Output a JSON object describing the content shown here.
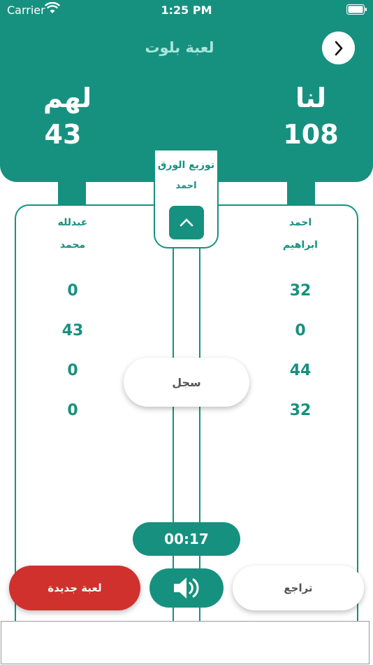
{
  "status_bar": {
    "carrier": "Carrier",
    "time": "1:25 PM"
  },
  "header": {
    "title": "لعبة بلوت",
    "team_us": {
      "label": "لنا",
      "score": "108"
    },
    "team_them": {
      "label": "لهم",
      "score": "43"
    }
  },
  "dealer": {
    "title": "توزيع الورق",
    "name": "احمد"
  },
  "players": {
    "us": [
      "احمد",
      "ابراهيم"
    ],
    "them": [
      "عبدلله",
      "محمد"
    ]
  },
  "rounds": {
    "us": [
      "32",
      "0",
      "44",
      "32"
    ],
    "them": [
      "0",
      "43",
      "0",
      "0"
    ]
  },
  "buttons": {
    "record": "سجل",
    "new_game": "لعبة جديدة",
    "undo": "تراجع"
  },
  "timer": "00:17",
  "colors": {
    "primary": "#17917f",
    "danger": "#d0312d",
    "header_title": "#a8e6dc"
  },
  "icons": {
    "nav": "chevron-right-icon",
    "dealer_toggle": "chevron-up-icon",
    "sound": "speaker-icon"
  }
}
